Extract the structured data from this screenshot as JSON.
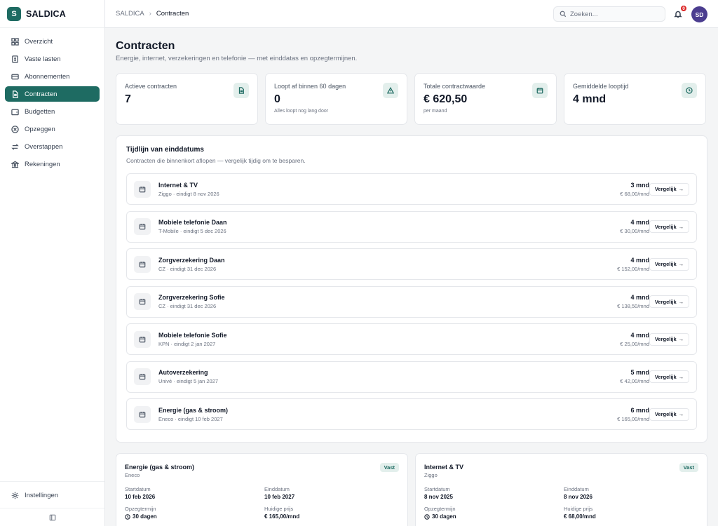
{
  "brand": {
    "logo": "S",
    "name": "SALDICA"
  },
  "nav": [
    {
      "label": "Overzicht",
      "icon": "grid-icon"
    },
    {
      "label": "Vaste lasten",
      "icon": "receipt-icon"
    },
    {
      "label": "Abonnementen",
      "icon": "card-icon"
    },
    {
      "label": "Contracten",
      "icon": "document-icon",
      "active": true
    },
    {
      "label": "Budgetten",
      "icon": "wallet-icon"
    },
    {
      "label": "Opzeggen",
      "icon": "cancel-icon"
    },
    {
      "label": "Overstappen",
      "icon": "switch-icon"
    },
    {
      "label": "Rekeningen",
      "icon": "bank-icon"
    }
  ],
  "settings_label": "Instellingen",
  "breadcrumb": {
    "root": "SALDICA",
    "current": "Contracten"
  },
  "search": {
    "placeholder": "Zoeken..."
  },
  "notifications": {
    "count": "0"
  },
  "user": {
    "initials": "SD"
  },
  "page": {
    "title": "Contracten",
    "subtitle": "Energie, internet, verzekeringen en telefonie — met einddatas en opzegtermijnen."
  },
  "stats": [
    {
      "label": "Actieve contracten",
      "value": "7",
      "hint": "",
      "icon": "document-icon"
    },
    {
      "label": "Loopt af binnen 60 dagen",
      "value": "0",
      "hint": "Alles loopt nog lang door",
      "icon": "warning-icon"
    },
    {
      "label": "Totale contractwaarde",
      "value": "€ 620,50",
      "hint": "per maand",
      "icon": "calendar-icon"
    },
    {
      "label": "Gemiddelde looptijd",
      "value": "4 mnd",
      "hint": "",
      "icon": "clock-icon"
    }
  ],
  "timeline": {
    "title": "Tijdlijn van einddatums",
    "subtitle": "Contracten die binnenkort aflopen — vergelijk tijdig om te besparen.",
    "button_label": "Vergelijk",
    "rows": [
      {
        "name": "Internet & TV",
        "meta": "Ziggo · eindigt 8 nov 2026",
        "duration": "3 mnd",
        "price": "€ 68,00/mnd"
      },
      {
        "name": "Mobiele telefonie Daan",
        "meta": "T-Mobile · eindigt 5 dec 2026",
        "duration": "4 mnd",
        "price": "€ 30,00/mnd"
      },
      {
        "name": "Zorgverzekering Daan",
        "meta": "CZ · eindigt 31 dec 2026",
        "duration": "4 mnd",
        "price": "€ 152,00/mnd"
      },
      {
        "name": "Zorgverzekering Sofie",
        "meta": "CZ · eindigt 31 dec 2026",
        "duration": "4 mnd",
        "price": "€ 138,50/mnd"
      },
      {
        "name": "Mobiele telefonie Sofie",
        "meta": "KPN · eindigt 2 jan 2027",
        "duration": "4 mnd",
        "price": "€ 25,00/mnd"
      },
      {
        "name": "Autoverzekering",
        "meta": "Univé · eindigt 5 jan 2027",
        "duration": "5 mnd",
        "price": "€ 42,00/mnd"
      },
      {
        "name": "Energie (gas & stroom)",
        "meta": "Eneco · eindigt 10 feb 2027",
        "duration": "6 mnd",
        "price": "€ 165,00/mnd"
      }
    ]
  },
  "details": [
    {
      "name": "Energie (gas & stroom)",
      "provider": "Eneco",
      "badge": "Vast",
      "start_label": "Startdatum",
      "start": "10 feb 2026",
      "end_label": "Einddatum",
      "end": "10 feb 2027",
      "notice_label": "Opzegtermijn",
      "notice": "30 dagen",
      "price_label": "Huidige prijs",
      "price": "€ 165,00/mnd"
    },
    {
      "name": "Internet & TV",
      "provider": "Ziggo",
      "badge": "Vast",
      "start_label": "Startdatum",
      "start": "8 nov 2025",
      "end_label": "Einddatum",
      "end": "8 nov 2026",
      "notice_label": "Opzegtermijn",
      "notice": "30 dagen",
      "price_label": "Huidige prijs",
      "price": "€ 68,00/mnd"
    }
  ]
}
